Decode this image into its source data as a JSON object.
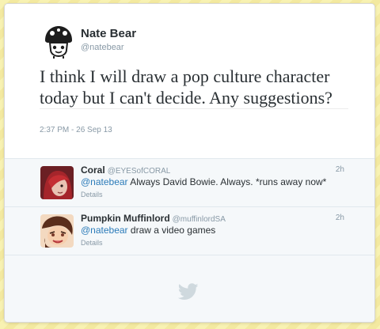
{
  "tweet": {
    "author_name": "Nate Bear",
    "author_handle": "@natebear",
    "text_lines": [
      "I think I will draw a pop culture character",
      "today but I can't decide. Any suggestions?"
    ],
    "timestamp": "2:37 PM - 26 Sep 13"
  },
  "replies": [
    {
      "name": "Coral",
      "handle": "@EYESofCORAL",
      "time": "2h",
      "mention": "@natebear",
      "text": " Always David Bowie. Always. *runs away now*",
      "details": "Details"
    },
    {
      "name": "Pumpkin Muffinlord",
      "handle": "@muffinlordSA",
      "time": "2h",
      "mention": "@natebear",
      "text": " draw a video games",
      "details": "Details"
    }
  ],
  "icons": {
    "footer": "twitter-bird-icon"
  },
  "colors": {
    "link": "#2b7bb9",
    "muted": "#8899a6",
    "text": "#292f33",
    "background_stripe": "#f8f2b2"
  }
}
